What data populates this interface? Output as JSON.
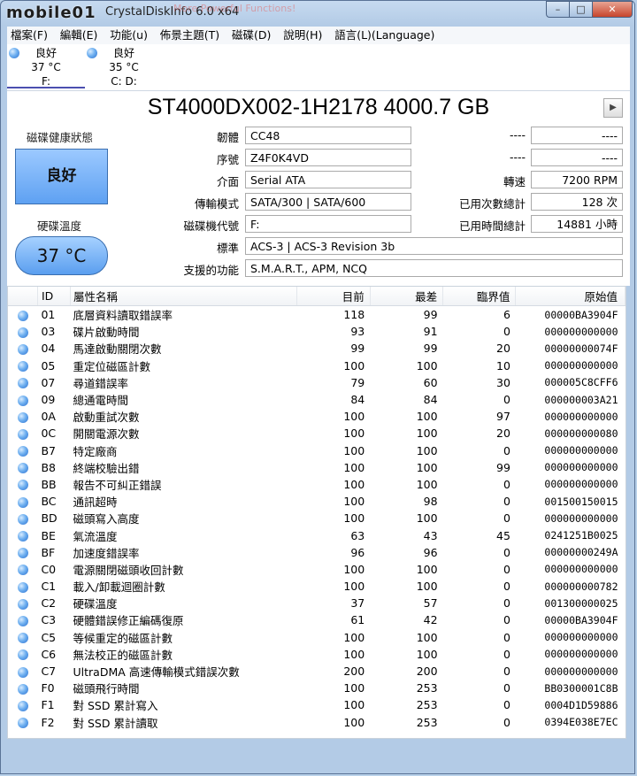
{
  "window": {
    "logo_text": "mobile01",
    "title": "CrystalDiskInfo 6.0 x64",
    "title_ad": "More Powerful Functions!",
    "controls": {
      "minimize": "–",
      "maximize": "□",
      "close": "✕"
    }
  },
  "menu": [
    "檔案(F)",
    "編輯(E)",
    "功能(u)",
    "佈景主題(T)",
    "磁碟(D)",
    "說明(H)",
    "語言(L)(Language)"
  ],
  "drives": [
    {
      "status": "良好",
      "temp": "37 °C",
      "letter": "F:",
      "active": true
    },
    {
      "status": "良好",
      "temp": "35 °C",
      "letter": "C: D:",
      "active": false
    }
  ],
  "disk": {
    "model": "ST4000DX002-1H2178 4000.7 GB",
    "health_label": "磁碟健康狀態",
    "health": "良好",
    "temp_label": "硬碟溫度",
    "temperature": "37 °C",
    "fields": {
      "firmware_label": "韌體",
      "firmware": "CC48",
      "serial_label": "序號",
      "serial": "Z4F0K4VD",
      "interface_label": "介面",
      "interface": "Serial ATA",
      "transfer_label": "傳輸模式",
      "transfer": "SATA/300 | SATA/600",
      "drive_letter_label": "磁碟機代號",
      "drive_letter": "F:",
      "standard_label": "標準",
      "standard": "ACS-3 | ACS-3 Revision 3b",
      "features_label": "支援的功能",
      "features": "S.M.A.R.T., APM, NCQ",
      "blank1_label": "----",
      "blank1": "----",
      "blank2_label": "----",
      "blank2": "----",
      "rotation_label": "轉速",
      "rotation": "7200 RPM",
      "power_count_label": "已用次數總計",
      "power_count": "128 次",
      "power_hours_label": "已用時間總計",
      "power_hours": "14881 小時"
    }
  },
  "smart": {
    "headers": [
      "ID",
      "屬性名稱",
      "目前",
      "最差",
      "臨界值",
      "原始值"
    ],
    "rows": [
      [
        "01",
        "底層資料讀取錯誤率",
        "118",
        "99",
        "6",
        "00000BA3904F"
      ],
      [
        "03",
        "碟片啟動時間",
        "93",
        "91",
        "0",
        "000000000000"
      ],
      [
        "04",
        "馬達啟動關閉次數",
        "99",
        "99",
        "20",
        "00000000074F"
      ],
      [
        "05",
        "重定位磁區計數",
        "100",
        "100",
        "10",
        "000000000000"
      ],
      [
        "07",
        "尋道錯誤率",
        "79",
        "60",
        "30",
        "000005C8CFF6"
      ],
      [
        "09",
        "總通電時間",
        "84",
        "84",
        "0",
        "000000003A21"
      ],
      [
        "0A",
        "啟動重試次數",
        "100",
        "100",
        "97",
        "000000000000"
      ],
      [
        "0C",
        "開關電源次數",
        "100",
        "100",
        "20",
        "000000000080"
      ],
      [
        "B7",
        "特定廠商",
        "100",
        "100",
        "0",
        "000000000000"
      ],
      [
        "B8",
        "終端校驗出錯",
        "100",
        "100",
        "99",
        "000000000000"
      ],
      [
        "BB",
        "報告不可糾正錯誤",
        "100",
        "100",
        "0",
        "000000000000"
      ],
      [
        "BC",
        "通訊超時",
        "100",
        "98",
        "0",
        "001500150015"
      ],
      [
        "BD",
        "磁頭寫入高度",
        "100",
        "100",
        "0",
        "000000000000"
      ],
      [
        "BE",
        "氣流溫度",
        "63",
        "43",
        "45",
        "0241251B0025"
      ],
      [
        "BF",
        "加速度錯誤率",
        "96",
        "96",
        "0",
        "00000000249A"
      ],
      [
        "C0",
        "電源關閉磁頭收回計數",
        "100",
        "100",
        "0",
        "000000000000"
      ],
      [
        "C1",
        "載入/卸載迴圈計數",
        "100",
        "100",
        "0",
        "000000000782"
      ],
      [
        "C2",
        "硬碟溫度",
        "37",
        "57",
        "0",
        "001300000025"
      ],
      [
        "C3",
        "硬體錯誤修正編碼復原",
        "61",
        "42",
        "0",
        "00000BA3904F"
      ],
      [
        "C5",
        "等候重定的磁區計數",
        "100",
        "100",
        "0",
        "000000000000"
      ],
      [
        "C6",
        "無法校正的磁區計數",
        "100",
        "100",
        "0",
        "000000000000"
      ],
      [
        "C7",
        "UltraDMA 高速傳輸模式錯誤次數",
        "200",
        "200",
        "0",
        "000000000000"
      ],
      [
        "F0",
        "磁頭飛行時間",
        "100",
        "253",
        "0",
        "BB0300001C8B"
      ],
      [
        "F1",
        "對 SSD 累計寫入",
        "100",
        "253",
        "0",
        "0004D1D59886"
      ],
      [
        "F2",
        "對 SSD 累計讀取",
        "100",
        "253",
        "0",
        "0394E038E7EC"
      ]
    ]
  },
  "colors": {
    "health_good": "#5ea1f2",
    "window_frame": "#b3cbe6",
    "status_dot": "#2b6fd0"
  }
}
